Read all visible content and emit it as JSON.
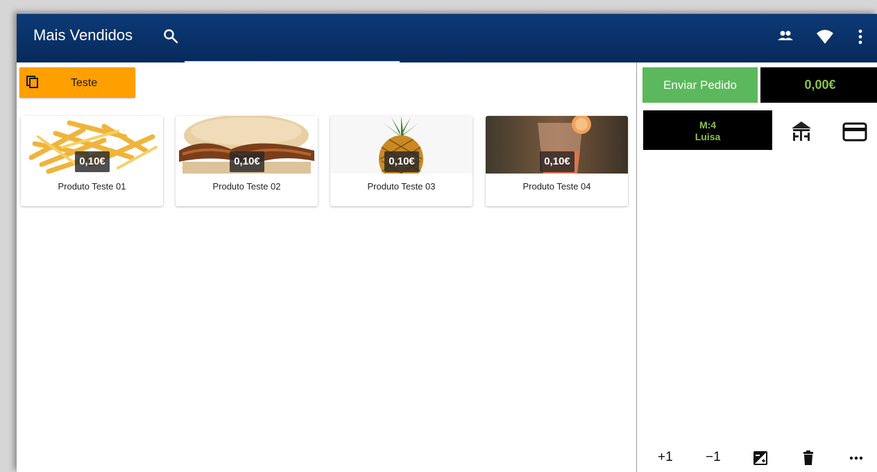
{
  "appbar": {
    "title": "Mais Vendidos",
    "icons": [
      "search-icon",
      "people-icon",
      "wifi-icon",
      "more-vert-icon"
    ]
  },
  "category": {
    "label": "Teste",
    "icon": "copy-icon",
    "color": "#ff9f00"
  },
  "products": [
    {
      "name": "Produto Teste 01",
      "price": "0,10€"
    },
    {
      "name": "Produto Teste 02",
      "price": "0,10€"
    },
    {
      "name": "Produto Teste 03",
      "price": "0,10€"
    },
    {
      "name": "Produto Teste 04",
      "price": "0,10€"
    }
  ],
  "order": {
    "send_label": "Enviar Pedido",
    "total": "0,00€",
    "table_line1": "M:4",
    "table_line2": "Luisa",
    "icons": [
      "table-icon",
      "credit-card-icon"
    ]
  },
  "actions": {
    "plus_one": "+1",
    "minus_one": "−1",
    "icons": [
      "edit-price-icon",
      "delete-icon",
      "more-horiz-icon"
    ]
  },
  "colors": {
    "appbar": "#062a5c",
    "send": "#5cb85c",
    "total_text": "#8bc34a"
  }
}
